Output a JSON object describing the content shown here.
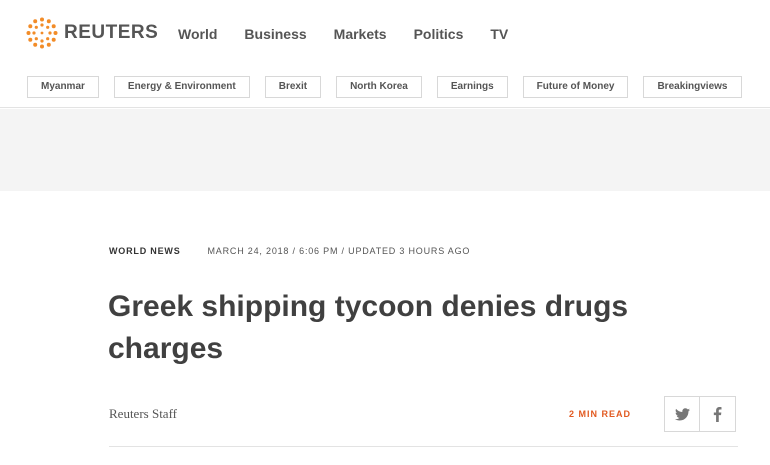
{
  "header": {
    "brand": "REUTERS",
    "nav": [
      "World",
      "Business",
      "Markets",
      "Politics",
      "TV"
    ],
    "topics": [
      "Myanmar",
      "Energy & Environment",
      "Brexit",
      "North Korea",
      "Earnings",
      "Future of Money",
      "Breakingviews"
    ]
  },
  "article": {
    "channel": "WORLD NEWS",
    "timestamp": "MARCH 24, 2018 / 6:06 PM / UPDATED 3 HOURS AGO",
    "headline": "Greek shipping tycoon denies drugs charges",
    "byline": "Reuters Staff",
    "read_time": "2 MIN READ"
  },
  "share": {
    "twitter_icon": "twitter-icon",
    "facebook_icon": "facebook-icon"
  },
  "colors": {
    "brand_orange": "#f28c28",
    "read_time": "#e25a21",
    "ad_band": "#f4f4f4"
  }
}
